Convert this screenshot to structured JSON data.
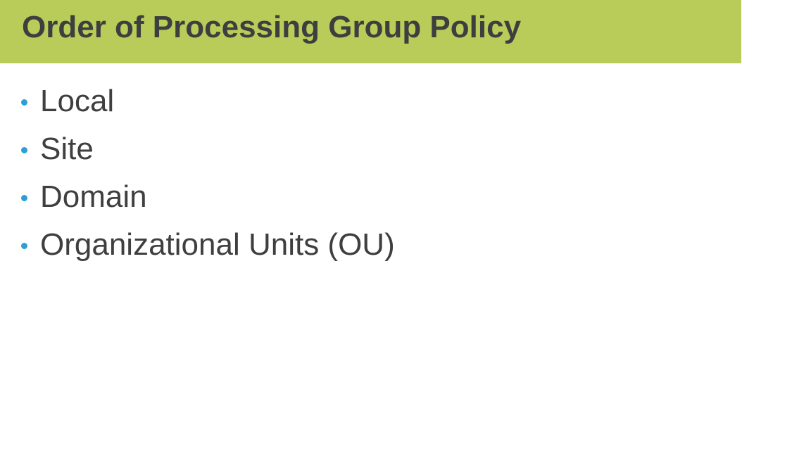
{
  "slide": {
    "title": "Order of Processing Group Policy",
    "bullets": [
      {
        "label": "Local"
      },
      {
        "label": "Site"
      },
      {
        "label": "Domain"
      },
      {
        "label": "Organizational Units (OU)"
      }
    ]
  },
  "colors": {
    "title_bar": "#b9cc59",
    "title_text": "#3d3f3f",
    "body_text": "#3f3f3f",
    "bullet": "#2e9fd3"
  },
  "icons": {
    "bullet": "bullet-dot-icon"
  }
}
